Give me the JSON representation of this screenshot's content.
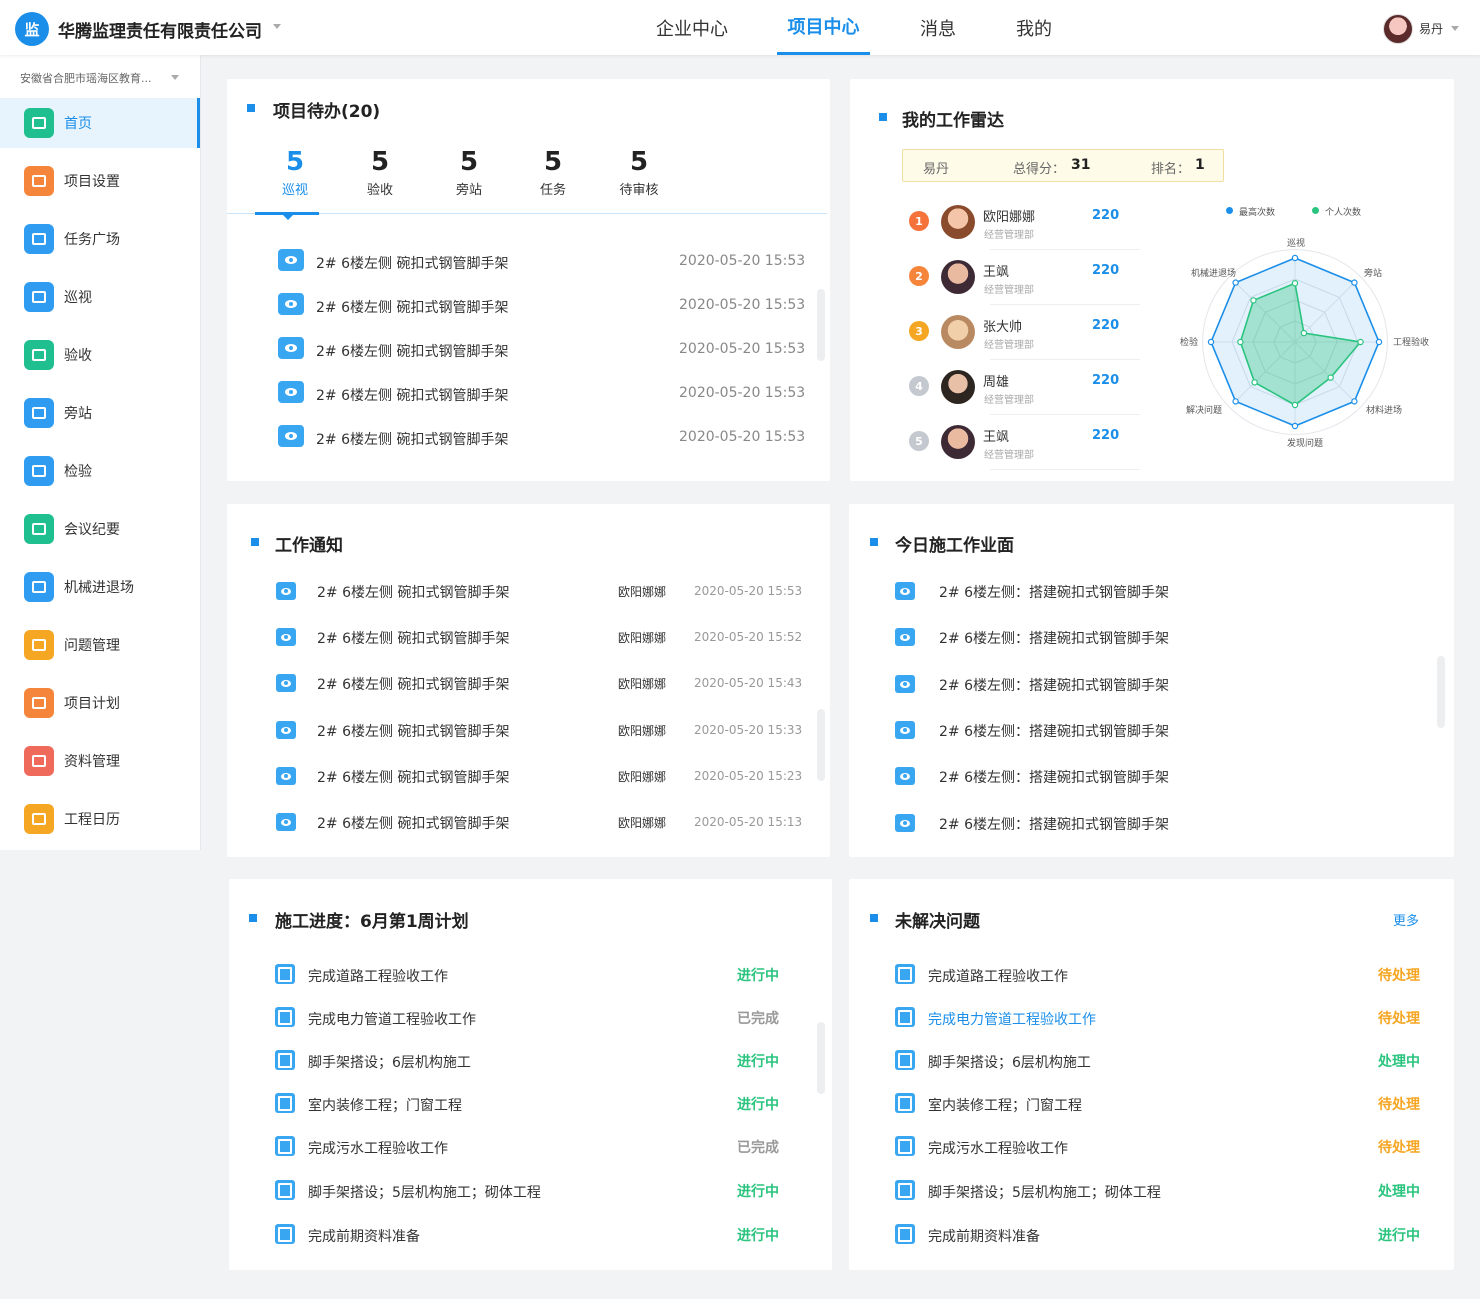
{
  "header": {
    "logo_text": "监",
    "company": "华腾监理责任有限责任公司",
    "nav": [
      "企业中心",
      "项目中心",
      "消息",
      "我的"
    ],
    "active_nav": 1,
    "user_name": "易丹"
  },
  "sidebar": {
    "project": "安徽省合肥市瑶海区教育...",
    "items": [
      {
        "label": "首页",
        "icon": "calendar-icon",
        "color": "#1fbf8f"
      },
      {
        "label": "项目设置",
        "icon": "wrench-icon",
        "color": "#f5853a"
      },
      {
        "label": "任务广场",
        "icon": "flag-icon",
        "color": "#2f9cf2"
      },
      {
        "label": "巡视",
        "icon": "eye-icon",
        "color": "#2f9cf2"
      },
      {
        "label": "验收",
        "icon": "check-icon",
        "color": "#1fbf8f"
      },
      {
        "label": "旁站",
        "icon": "location-icon",
        "color": "#2f9cf2"
      },
      {
        "label": "检验",
        "icon": "ruler-icon",
        "color": "#2f9cf2"
      },
      {
        "label": "会议纪要",
        "icon": "board-icon",
        "color": "#1fbf8f"
      },
      {
        "label": "机械进退场",
        "icon": "truck-icon",
        "color": "#2f9cf2"
      },
      {
        "label": "问题管理",
        "icon": "question-icon",
        "color": "#f5a623"
      },
      {
        "label": "项目计划",
        "icon": "plan-icon",
        "color": "#f5853a"
      },
      {
        "label": "资料管理",
        "icon": "file-icon",
        "color": "#f06a5b"
      },
      {
        "label": "工程日历",
        "icon": "date-icon",
        "color": "#f5a623"
      }
    ]
  },
  "todo": {
    "title": "项目待办(20)",
    "tabs": [
      {
        "num": "5",
        "label": "巡视"
      },
      {
        "num": "5",
        "label": "验收"
      },
      {
        "num": "5",
        "label": "旁站"
      },
      {
        "num": "5",
        "label": "任务"
      },
      {
        "num": "5",
        "label": "待审核"
      }
    ],
    "items": [
      {
        "text": "2# 6楼左侧 碗扣式钢管脚手架",
        "time": "2020-05-20 15:53"
      },
      {
        "text": "2# 6楼左侧 碗扣式钢管脚手架",
        "time": "2020-05-20 15:53"
      },
      {
        "text": "2# 6楼左侧 碗扣式钢管脚手架",
        "time": "2020-05-20 15:53"
      },
      {
        "text": "2# 6楼左侧 碗扣式钢管脚手架",
        "time": "2020-05-20 15:53"
      },
      {
        "text": "2# 6楼左侧 碗扣式钢管脚手架",
        "time": "2020-05-20 15:53"
      }
    ]
  },
  "radar": {
    "title": "我的工作雷达",
    "summary": {
      "name": "易丹",
      "score_label": "总得分：",
      "score": "31",
      "rank_label": "排名：",
      "rank": "1"
    },
    "legend": [
      {
        "name": "最高次数",
        "color": "#1a8ee9"
      },
      {
        "name": "个人次数",
        "color": "#2ac47f"
      }
    ],
    "ranking": [
      {
        "rank": "1",
        "name": "欧阳娜娜",
        "dept": "经营管理部",
        "score": "220",
        "badge_color": "#f5733a"
      },
      {
        "rank": "2",
        "name": "王飒",
        "dept": "经营管理部",
        "score": "220",
        "badge_color": "#f5853a"
      },
      {
        "rank": "3",
        "name": "张大帅",
        "dept": "经营管理部",
        "score": "220",
        "badge_color": "#f5a623"
      },
      {
        "rank": "4",
        "name": "周雄",
        "dept": "经营管理部",
        "score": "220",
        "badge_color": "#c4c8cf"
      },
      {
        "rank": "5",
        "name": "王飒",
        "dept": "经营管理部",
        "score": "220",
        "badge_color": "#c4c8cf"
      }
    ]
  },
  "chart_data": {
    "type": "radar",
    "categories": [
      "巡视",
      "旁站",
      "工程验收",
      "材料进场",
      "发现问题",
      "解决问题",
      "检验",
      "机械进退场"
    ],
    "max": 100,
    "series": [
      {
        "name": "最高次数",
        "values": [
          100,
          100,
          100,
          100,
          100,
          100,
          100,
          100
        ],
        "color": "#1a8ee9"
      },
      {
        "name": "个人次数",
        "values": [
          70,
          15,
          78,
          60,
          75,
          68,
          65,
          70
        ],
        "color": "#2ac47f"
      }
    ]
  },
  "notice": {
    "title": "工作通知",
    "items": [
      {
        "text": "2# 6楼左侧 碗扣式钢管脚手架",
        "user": "欧阳娜娜",
        "time": "2020-05-20 15:53"
      },
      {
        "text": "2# 6楼左侧 碗扣式钢管脚手架",
        "user": "欧阳娜娜",
        "time": "2020-05-20 15:52"
      },
      {
        "text": "2# 6楼左侧 碗扣式钢管脚手架",
        "user": "欧阳娜娜",
        "time": "2020-05-20 15:43"
      },
      {
        "text": "2# 6楼左侧 碗扣式钢管脚手架",
        "user": "欧阳娜娜",
        "time": "2020-05-20 15:33"
      },
      {
        "text": "2# 6楼左侧 碗扣式钢管脚手架",
        "user": "欧阳娜娜",
        "time": "2020-05-20 15:23"
      },
      {
        "text": "2# 6楼左侧 碗扣式钢管脚手架",
        "user": "欧阳娜娜",
        "time": "2020-05-20 15:13"
      }
    ]
  },
  "worksite": {
    "title": "今日施工作业面",
    "items": [
      "2# 6楼左侧：搭建碗扣式钢管脚手架",
      "2# 6楼左侧：搭建碗扣式钢管脚手架",
      "2# 6楼左侧：搭建碗扣式钢管脚手架",
      "2# 6楼左侧：搭建碗扣式钢管脚手架",
      "2# 6楼左侧：搭建碗扣式钢管脚手架",
      "2# 6楼左侧：搭建碗扣式钢管脚手架"
    ]
  },
  "progress": {
    "title": "施工进度：6月第1周计划",
    "items": [
      {
        "text": "完成道路工程验收工作",
        "status": "进行中",
        "color": "#2ac47f"
      },
      {
        "text": "完成电力管道工程验收工作",
        "status": "已完成",
        "color": "#999999"
      },
      {
        "text": "脚手架搭设；6层机构施工",
        "status": "进行中",
        "color": "#2ac47f"
      },
      {
        "text": "室内装修工程；门窗工程",
        "status": "进行中",
        "color": "#2ac47f"
      },
      {
        "text": "完成污水工程验收工作",
        "status": "已完成",
        "color": "#999999"
      },
      {
        "text": "脚手架搭设；5层机构施工；砌体工程",
        "status": "进行中",
        "color": "#2ac47f"
      },
      {
        "text": "完成前期资料准备",
        "status": "进行中",
        "color": "#2ac47f"
      }
    ]
  },
  "issues": {
    "title": "未解决问题",
    "more": "更多",
    "items": [
      {
        "text": "完成道路工程验收工作",
        "status": "待处理",
        "color": "#f5a623",
        "highlight": false
      },
      {
        "text": "完成电力管道工程验收工作",
        "status": "待处理",
        "color": "#f5a623",
        "highlight": true
      },
      {
        "text": "脚手架搭设；6层机构施工",
        "status": "处理中",
        "color": "#2ac47f",
        "highlight": false
      },
      {
        "text": "室内装修工程；门窗工程",
        "status": "待处理",
        "color": "#f5a623",
        "highlight": false
      },
      {
        "text": "完成污水工程验收工作",
        "status": "待处理",
        "color": "#f5a623",
        "highlight": false
      },
      {
        "text": "脚手架搭设；5层机构施工；砌体工程",
        "status": "处理中",
        "color": "#2ac47f",
        "highlight": false
      },
      {
        "text": "完成前期资料准备",
        "status": "进行中",
        "color": "#2ac47f",
        "highlight": false
      }
    ]
  }
}
